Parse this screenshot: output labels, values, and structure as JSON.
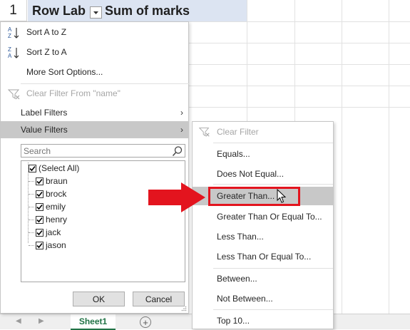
{
  "sheet": {
    "row_number": "1",
    "header_col_a": "Row Lab",
    "header_col_b": "Sum of marks",
    "active_tab": "Sheet1",
    "add_sheet_glyph": "+"
  },
  "panel": {
    "sort_a_to_z": "Sort A to Z",
    "sort_z_to_a": "Sort Z to A",
    "more_sort_options": "More Sort Options...",
    "clear_filter": "Clear Filter From \"name\"",
    "label_filters": "Label Filters",
    "value_filters": "Value Filters",
    "search_placeholder": "Search",
    "items": [
      "(Select All)",
      "braun",
      "brock",
      "emily",
      "henry",
      "jack",
      "jason"
    ],
    "ok": "OK",
    "cancel": "Cancel"
  },
  "submenu": {
    "clear_filter": "Clear Filter",
    "equals": "Equals...",
    "does_not_equal": "Does Not Equal...",
    "greater_than": "Greater Than...",
    "greater_than_or_equal": "Greater Than Or Equal To...",
    "less_than": "Less Than...",
    "less_than_or_equal": "Less Than Or Equal To...",
    "between": "Between...",
    "not_between": "Not Between...",
    "top_10": "Top 10..."
  },
  "colors": {
    "header_fill": "#dce4f2",
    "highlight": "#c8c8c8",
    "annotation_red": "#e3141e",
    "excel_green": "#217346"
  },
  "icons": [
    "sort-az-icon",
    "sort-za-icon",
    "clear-filter-icon",
    "search-icon",
    "dropdown-filter-icon",
    "chevron-right-icon",
    "checkbox-checked-icon",
    "mouse-cursor-icon",
    "red-arrow-icon"
  ]
}
